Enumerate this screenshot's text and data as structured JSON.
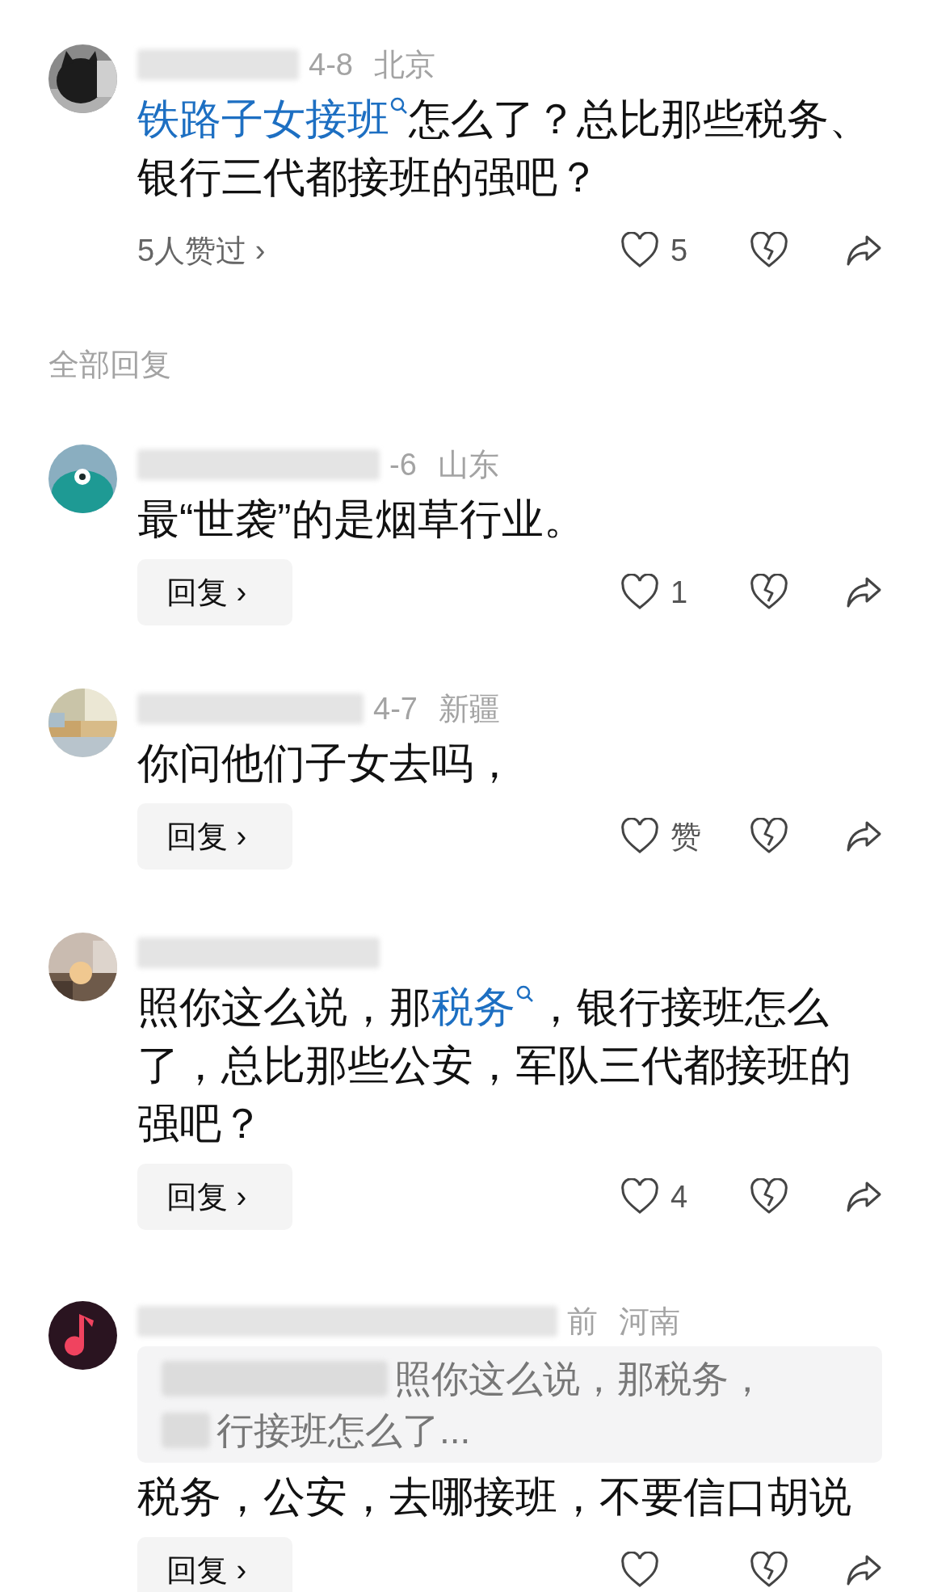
{
  "top_comment": {
    "avatar": {
      "kind": "cat_photo"
    },
    "date": "4-8",
    "location": "北京",
    "body": [
      {
        "kind": "link",
        "text": "铁路子女接班"
      },
      {
        "kind": "plain",
        "text": "怎么了？总比那些税务、银行三代都接班的强吧？"
      }
    ],
    "liked_by": "5人赞过 ›",
    "like_label": "5"
  },
  "section_title": "全部回复",
  "replies": [
    {
      "avatar": {
        "kind": "teal_monster"
      },
      "date": "-6",
      "location": "山东",
      "body": [
        {
          "kind": "plain",
          "text": "最“世袭”的是烟草行业。"
        }
      ],
      "reply_button": "回复 ›",
      "like_label": "1"
    },
    {
      "avatar": {
        "kind": "beach_photo"
      },
      "date": "4-7",
      "location": "新疆",
      "body": [
        {
          "kind": "plain",
          "text": "你问他们子女去吗，"
        }
      ],
      "reply_button": "回复 ›",
      "like_label": "赞"
    },
    {
      "avatar": {
        "kind": "sunset_photo"
      },
      "body": [
        {
          "kind": "plain",
          "text": "照你这么说，那"
        },
        {
          "kind": "link",
          "text": "税务"
        },
        {
          "kind": "plain",
          "text": "，银行接班怎么了，总比那些公安，军队三代都接班的强吧？"
        }
      ],
      "reply_button": "回复 ›",
      "like_label": "4"
    },
    {
      "avatar": {
        "kind": "music_note"
      },
      "date": "前",
      "location": "河南",
      "quote_lines": [
        "照你这么说，那税务，",
        "行接班怎么了..."
      ],
      "body": [
        {
          "kind": "plain",
          "text": "税务，公安，去哪接班，不要信口胡说"
        }
      ],
      "reply_button": "回复 ›"
    }
  ]
}
